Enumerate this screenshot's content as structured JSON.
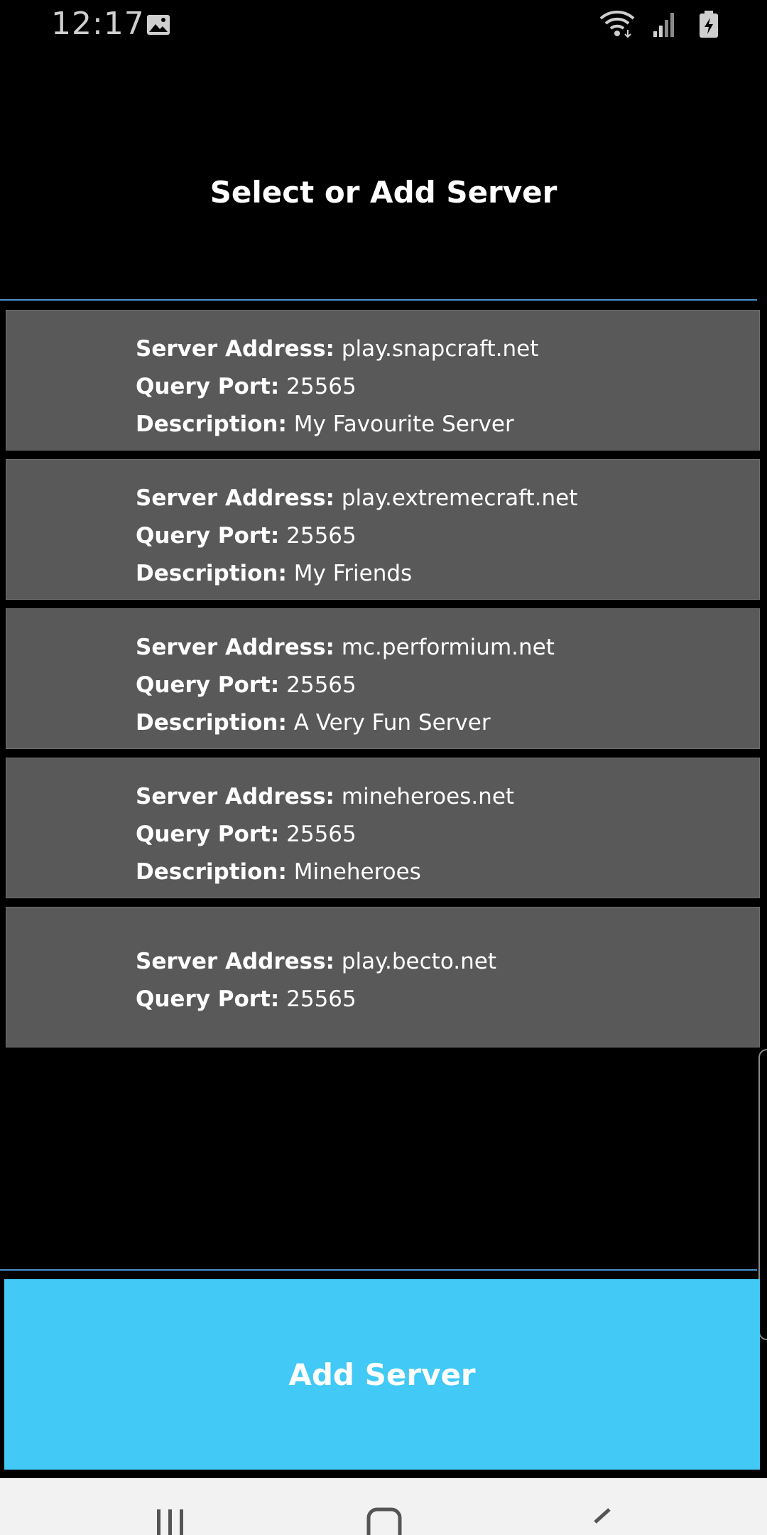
{
  "status_bar": {
    "time": "12:17",
    "icons": [
      "image-icon",
      "wifi-icon",
      "signal-icon",
      "battery-charging-icon"
    ]
  },
  "header": {
    "title": "Select or Add Server"
  },
  "labels": {
    "address": "Server Address:",
    "port": "Query Port:",
    "description": "Description:"
  },
  "servers": [
    {
      "address": "play.snapcraft.net",
      "port": "25565",
      "description": "My Favourite Server"
    },
    {
      "address": "play.extremecraft.net",
      "port": "25565",
      "description": "My Friends"
    },
    {
      "address": "mc.performium.net",
      "port": "25565",
      "description": "A Very Fun Server"
    },
    {
      "address": "mineheroes.net",
      "port": "25565",
      "description": "Mineheroes"
    },
    {
      "address": "play.becto.net",
      "port": "25565"
    }
  ],
  "actions": {
    "add_server": "Add Server"
  },
  "nav_bar": {
    "buttons": [
      "recents-icon",
      "home-icon",
      "back-icon"
    ]
  },
  "colors": {
    "background": "#000000",
    "card": "#595959",
    "divider": "#4a90c8",
    "accent_button": "#42c9f5",
    "text": "#ffffff"
  }
}
